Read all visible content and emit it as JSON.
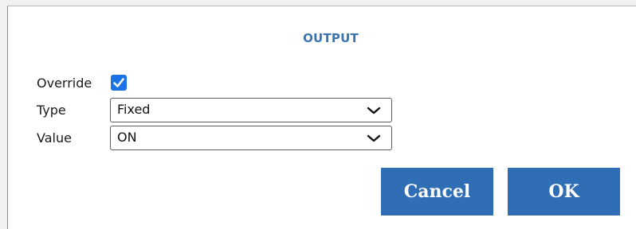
{
  "dialog": {
    "title": "OUTPUT",
    "override": {
      "label": "Override",
      "checked": true
    },
    "type": {
      "label": "Type",
      "value": "Fixed"
    },
    "value": {
      "label": "Value",
      "value": "ON"
    },
    "buttons": {
      "cancel": "Cancel",
      "ok": "OK"
    }
  },
  "colors": {
    "accent": "#2f6db5",
    "title": "#3a75b3",
    "checkbox": "#1a74e5"
  },
  "icons": {
    "checkbox_mark": "check-icon",
    "dropdown": "chevron-down-icon"
  }
}
